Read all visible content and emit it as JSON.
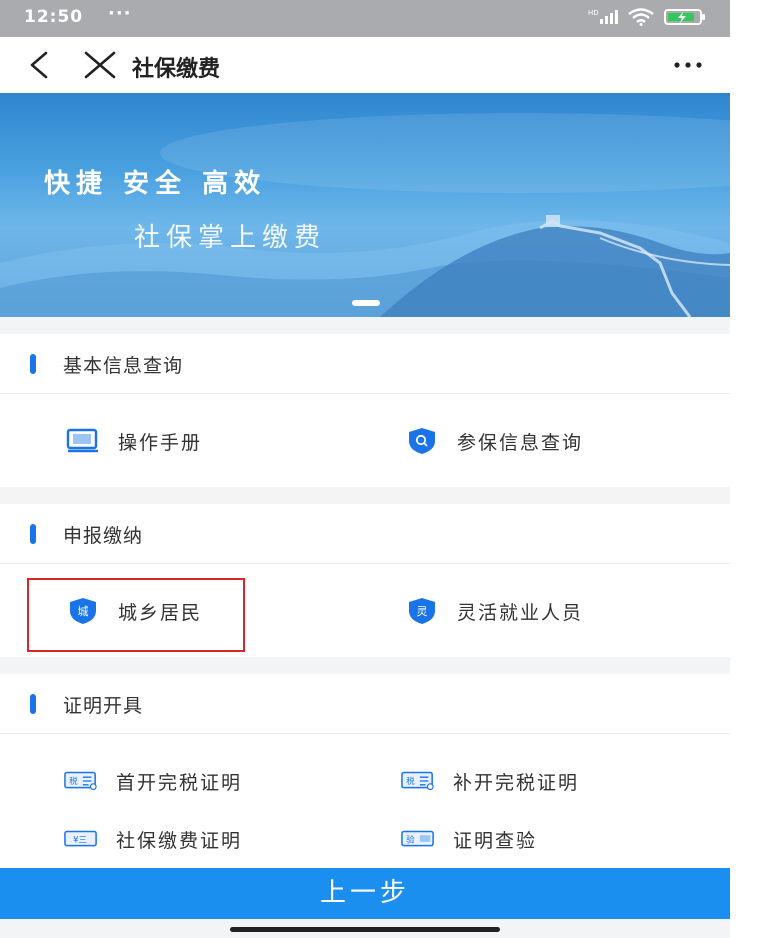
{
  "status_bar": {
    "time": "12:50",
    "dots": "···",
    "network_label": "HD"
  },
  "nav": {
    "title": "社保缴费"
  },
  "banner": {
    "line1": "快捷  安全  高效",
    "line2": "社保掌上缴费"
  },
  "sections": [
    {
      "title": "基本信息查询",
      "items": [
        {
          "label": "操作手册",
          "icon": "manual-icon"
        },
        {
          "label": "参保信息查询",
          "icon": "shield-search-icon"
        }
      ]
    },
    {
      "title": "申报缴纳",
      "items": [
        {
          "label": "城乡居民",
          "icon": "shield-icon",
          "badge": "城"
        },
        {
          "label": "灵活就业人员",
          "icon": "shield-icon",
          "badge": "灵"
        }
      ]
    },
    {
      "title": "证明开具",
      "items": [
        {
          "label": "首开完税证明",
          "icon": "tax-doc-icon",
          "badge": "税"
        },
        {
          "label": "补开完税证明",
          "icon": "tax-doc-icon",
          "badge": "税"
        },
        {
          "label": "社保缴费证明",
          "icon": "yuan-doc-icon",
          "badge": "¥三"
        },
        {
          "label": "证明查验",
          "icon": "verify-doc-icon",
          "badge": "验"
        }
      ]
    }
  ],
  "footer": {
    "button_label": "上一步"
  },
  "colors": {
    "accent": "#1a73e8",
    "button": "#1b8ff0",
    "highlight": "#d9262c"
  }
}
